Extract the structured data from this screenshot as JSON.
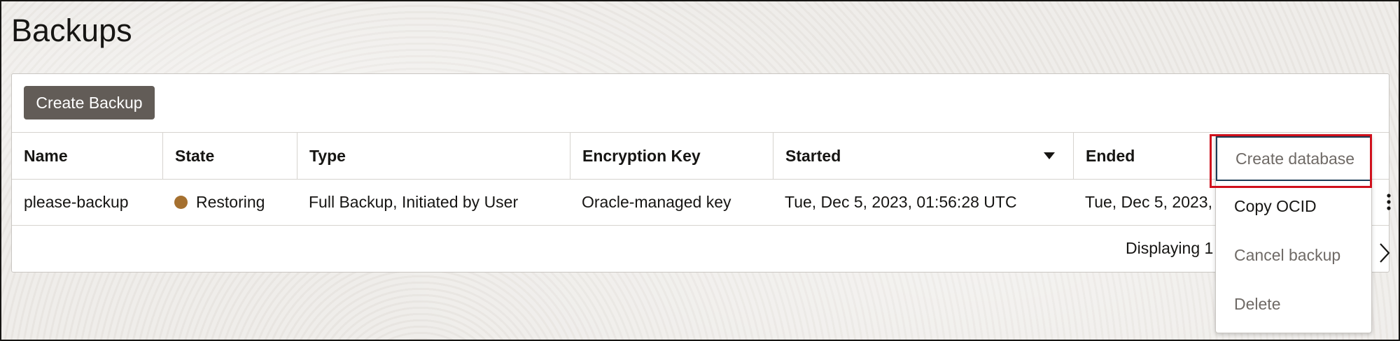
{
  "page": {
    "title": "Backups"
  },
  "toolbar": {
    "create_backup_label": "Create Backup"
  },
  "table": {
    "columns": [
      "Name",
      "State",
      "Type",
      "Encryption Key",
      "Started",
      "Ended"
    ],
    "rows": [
      {
        "name": "please-backup",
        "state": "Restoring",
        "type": "Full Backup, Initiated by User",
        "encryption_key": "Oracle-managed key",
        "started": "Tue, Dec 5, 2023, 01:56:28 UTC",
        "ended": "Tue, Dec 5, 2023,"
      }
    ],
    "sort": {
      "column": "Started",
      "direction": "descending"
    },
    "footer": "Displaying 1"
  },
  "state_colors": {
    "Restoring": "#a5702f"
  },
  "context_menu": {
    "items": [
      "Create database",
      "Copy OCID",
      "Cancel backup",
      "Delete"
    ],
    "highlighted": "Create database"
  },
  "colors": {
    "primary_button": "#625c57",
    "highlight_border": "#d0101c"
  }
}
